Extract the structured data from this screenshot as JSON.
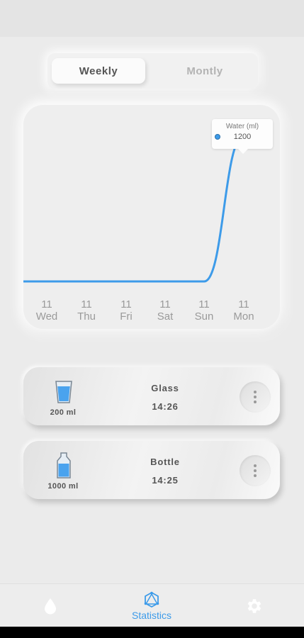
{
  "period_toggle": {
    "weekly_label": "Weekly",
    "monthly_label": "Montly",
    "selected": "Weekly"
  },
  "chart_data": {
    "type": "line",
    "categories": [
      {
        "date": "11",
        "day": "Wed"
      },
      {
        "date": "11",
        "day": "Thu"
      },
      {
        "date": "11",
        "day": "Fri"
      },
      {
        "date": "11",
        "day": "Sat"
      },
      {
        "date": "11",
        "day": "Sun"
      },
      {
        "date": "11",
        "day": "Mon"
      }
    ],
    "series": [
      {
        "name": "Water (ml)",
        "values": [
          0,
          0,
          0,
          0,
          0,
          1200
        ],
        "color": "#3d9be9"
      }
    ],
    "ylim": [
      0,
      1250
    ],
    "tooltip": {
      "title": "Water (ml)",
      "value": "1200"
    },
    "grid": false
  },
  "log_entries": [
    {
      "name": "Glass",
      "time": "14:26",
      "amount": "200 ml",
      "icon": "glass-icon"
    },
    {
      "name": "Bottle",
      "time": "14:25",
      "amount": "1000 ml",
      "icon": "bottle-icon"
    }
  ],
  "bottom_nav": {
    "items": [
      {
        "icon": "water-drop-icon",
        "label": ""
      },
      {
        "icon": "statistics-icon",
        "label": "Statistics",
        "active": true
      },
      {
        "icon": "settings-gear-icon",
        "label": ""
      }
    ]
  },
  "colors": {
    "accent": "#3d9be9",
    "background": "#ebebeb",
    "muted_text": "#9a9a9a"
  }
}
